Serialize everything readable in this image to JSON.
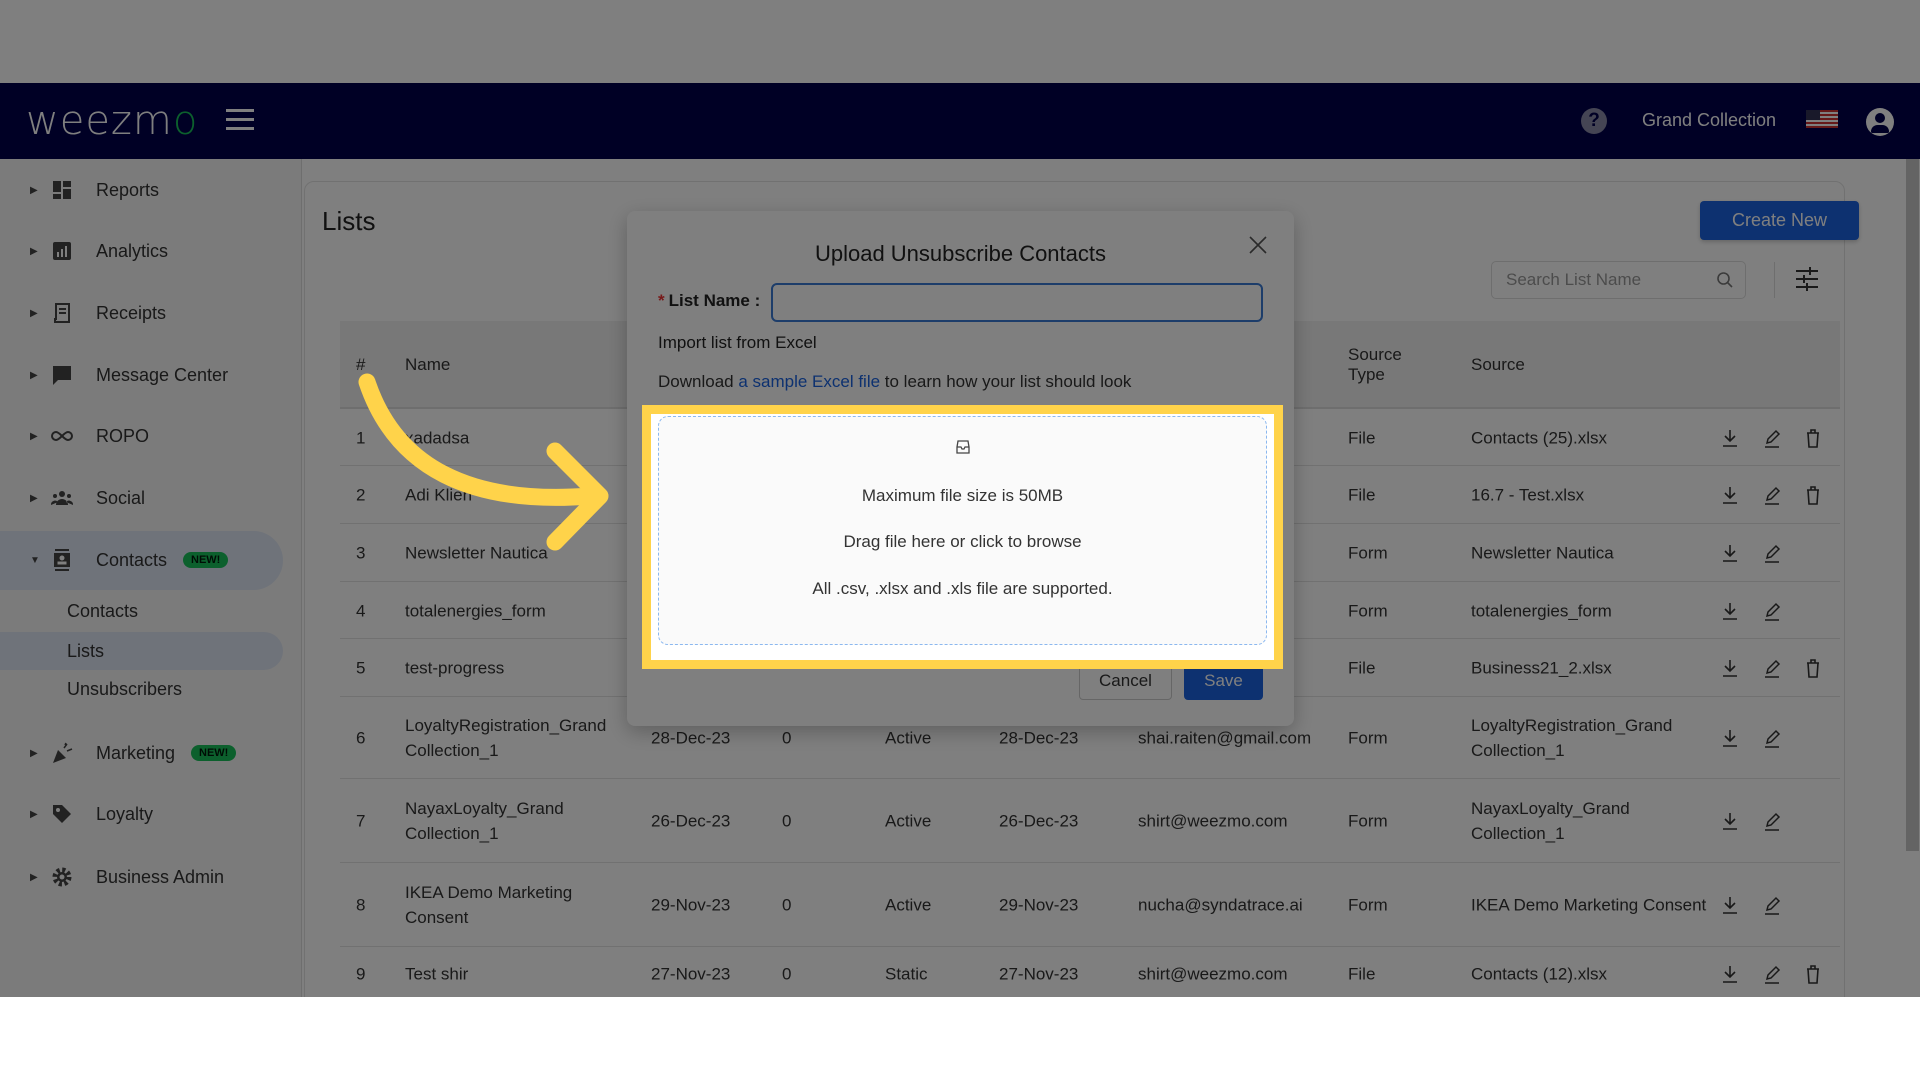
{
  "header": {
    "logo": "weezmo",
    "account_name": "Grand Collection",
    "help_icon": "question-circle-icon",
    "language": "en-US"
  },
  "sidebar": {
    "items": [
      {
        "label": "Reports",
        "icon": "dashboard-icon"
      },
      {
        "label": "Analytics",
        "icon": "bar-chart-icon"
      },
      {
        "label": "Receipts",
        "icon": "receipt-icon"
      },
      {
        "label": "Message Center",
        "icon": "chat-icon"
      },
      {
        "label": "ROPO",
        "icon": "infinity-icon"
      },
      {
        "label": "Social",
        "icon": "people-icon"
      },
      {
        "label": "Contacts",
        "icon": "contact-card-icon",
        "badge": "NEW!",
        "expanded": true
      },
      {
        "label": "Marketing",
        "icon": "party-popper-icon",
        "badge": "NEW!"
      },
      {
        "label": "Loyalty",
        "icon": "tag-icon"
      },
      {
        "label": "Business Admin",
        "icon": "gear-icon"
      }
    ],
    "contacts_sub": [
      {
        "label": "Contacts"
      },
      {
        "label": "Lists",
        "active": true
      },
      {
        "label": "Unsubscribers"
      }
    ]
  },
  "page": {
    "title": "Lists",
    "create_new": "Create New",
    "search_placeholder": "Search List Name"
  },
  "table": {
    "headers": {
      "num": "#",
      "name": "Name",
      "source_type": "Source Type",
      "source": "Source"
    },
    "rows": [
      {
        "num": "1",
        "name": "xadadsa",
        "date": "",
        "count": "",
        "status": "",
        "updated": "",
        "email": "",
        "source_type": "File",
        "source": "Contacts (25).xlsx",
        "delete": true
      },
      {
        "num": "2",
        "name": "Adi Klien",
        "date": "",
        "count": "",
        "status": "",
        "updated": "",
        "email": "",
        "source_type": "File",
        "source": "16.7 - Test.xlsx",
        "delete": true
      },
      {
        "num": "3",
        "name": "Newsletter Nautica",
        "date": "",
        "count": "",
        "status": "",
        "updated": "",
        "email": "",
        "source_type": "Form",
        "source": "Newsletter Nautica",
        "delete": false
      },
      {
        "num": "4",
        "name": "totalenergies_form",
        "date": "",
        "count": "",
        "status": "",
        "updated": "",
        "email": "",
        "source_type": "Form",
        "source": "totalenergies_form",
        "delete": false
      },
      {
        "num": "5",
        "name": "test-progress",
        "date": "",
        "count": "",
        "status": "",
        "updated": "",
        "email": "",
        "source_type": "File",
        "source": "Business21_2.xlsx",
        "delete": true
      },
      {
        "num": "6",
        "name": "LoyaltyRegistration_Grand Collection_1",
        "date": "28-Dec-23",
        "count": "0",
        "status": "Active",
        "updated": "28-Dec-23",
        "email": "shai.raiten@gmail.com",
        "source_type": "Form",
        "source": "LoyaltyRegistration_Grand Collection_1",
        "delete": false
      },
      {
        "num": "7",
        "name": "NayaxLoyalty_Grand Collection_1",
        "date": "26-Dec-23",
        "count": "0",
        "status": "Active",
        "updated": "26-Dec-23",
        "email": "shirt@weezmo.com",
        "source_type": "Form",
        "source": "NayaxLoyalty_Grand Collection_1",
        "delete": false
      },
      {
        "num": "8",
        "name": "IKEA Demo Marketing Consent",
        "date": "29-Nov-23",
        "count": "0",
        "status": "Active",
        "updated": "29-Nov-23",
        "email": "nucha@syndatrace.ai",
        "source_type": "Form",
        "source": "IKEA Demo Marketing Consent",
        "delete": false
      },
      {
        "num": "9",
        "name": "Test shir",
        "date": "27-Nov-23",
        "count": "0",
        "status": "Static",
        "updated": "27-Nov-23",
        "email": "shirt@weezmo.com",
        "source_type": "File",
        "source": "Contacts (12).xlsx",
        "delete": true
      }
    ]
  },
  "modal": {
    "title": "Upload Unsubscribe Contacts",
    "list_name_label": "List Name",
    "list_name_value": "",
    "import_label": "Import list from Excel",
    "download_prefix": "Download ",
    "download_link": "a sample Excel file",
    "download_suffix": " to learn how your list should look",
    "dropzone": {
      "icon": "inbox-icon",
      "max_size": "Maximum file size is 50MB",
      "instruction": "Drag file here or click to browse",
      "supported": "All .csv, .xlsx and .xls file are supported."
    },
    "cancel": "Cancel",
    "save": "Save"
  },
  "colors": {
    "header": "#00004a",
    "primary": "#1a63e0",
    "highlight": "#ffd34a",
    "badge": "#19c15a"
  }
}
